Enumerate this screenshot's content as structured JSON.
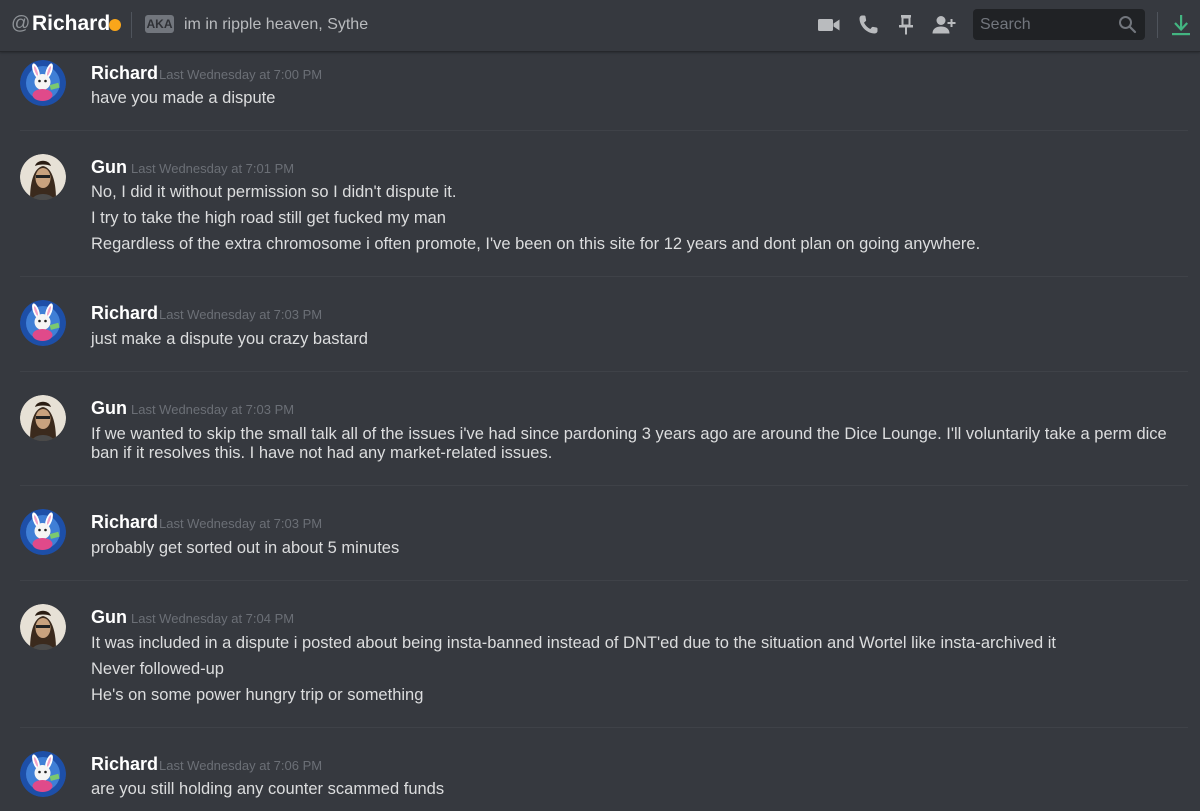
{
  "header": {
    "at_symbol": "@",
    "dm_name": "Richard",
    "status_color": "#faa61a",
    "aka_badge": "AKA",
    "aka_text": "im in ripple heaven, Sythe",
    "icons": [
      "video-call-icon",
      "voice-call-icon",
      "pin-icon",
      "add-friend-icon",
      "search-icon",
      "download-icon"
    ],
    "search": {
      "placeholder": "Search"
    }
  },
  "colors": {
    "background": "#36393f",
    "username": "#ffffff",
    "text": "#dcddde",
    "timestamp": "#6b6f76",
    "download_icon": "#43b581"
  },
  "messages": [
    {
      "author": "Richard",
      "timestamp": "Last Wednesday at 7:00 PM",
      "avatar": "richard-avatar",
      "lines": [
        "have you made a dispute"
      ]
    },
    {
      "author": "Gun",
      "timestamp": "Last Wednesday at 7:01 PM",
      "avatar": "gun-avatar",
      "lines": [
        "No, I did it without permission so I didn't dispute it.",
        "I try to take the high road still get fucked my man",
        "Regardless of the extra chromosome i often promote, I've been on this site for 12 years and dont plan on going anywhere."
      ]
    },
    {
      "author": "Richard",
      "timestamp": "Last Wednesday at 7:03 PM",
      "avatar": "richard-avatar",
      "lines": [
        "just make a dispute you crazy bastard"
      ]
    },
    {
      "author": "Gun",
      "timestamp": "Last Wednesday at 7:03 PM",
      "avatar": "gun-avatar",
      "lines": [
        "If we wanted to skip the small talk all of the issues i've had since pardoning 3 years ago are around the Dice Lounge.  I'll voluntarily take a perm dice ban if it resolves this.  I have not had any market-related issues."
      ]
    },
    {
      "author": "Richard",
      "timestamp": "Last Wednesday at 7:03 PM",
      "avatar": "richard-avatar",
      "lines": [
        "probably get sorted out in about 5 minutes"
      ]
    },
    {
      "author": "Gun",
      "timestamp": "Last Wednesday at 7:04 PM",
      "avatar": "gun-avatar",
      "lines": [
        "It was included in a dispute i posted about being insta-banned instead of DNT'ed due to the situation and Wortel like insta-archived it",
        "Never followed-up",
        "He's on some power hungry trip or something"
      ]
    },
    {
      "author": "Richard",
      "timestamp": "Last Wednesday at 7:06 PM",
      "avatar": "richard-avatar",
      "lines": [
        "are you still holding any counter scammed funds"
      ]
    }
  ]
}
